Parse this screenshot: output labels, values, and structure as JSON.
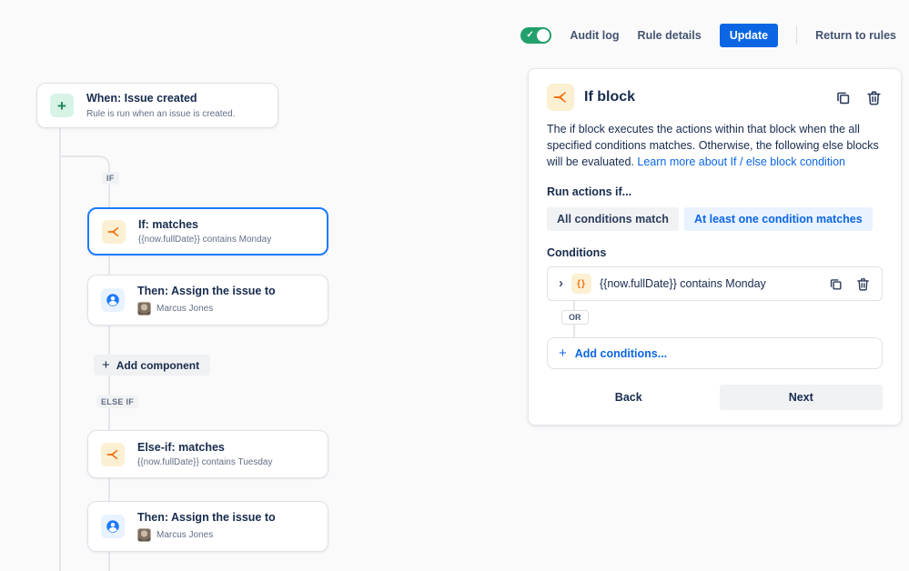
{
  "colors": {
    "accent_blue": "#0C66E4",
    "selected_border_blue": "#1D7AFC",
    "toggle_green": "#22A06B",
    "icon_orange": "#EE7213",
    "icon_orange_bg": "#FCF0D3",
    "icon_blue_bg": "#E9F2FF",
    "icon_green_bg": "#D6F3E6",
    "text_primary": "#172B4D",
    "text_secondary": "#626F86",
    "connector_gray": "#E4E6EA"
  },
  "icons": {
    "plus": "+",
    "check": "✓",
    "chevron_right": "›",
    "braces": "{}"
  },
  "topbar": {
    "audit_log": "Audit log",
    "rule_details": "Rule details",
    "update": "Update",
    "return_to_rules": "Return to rules"
  },
  "canvas": {
    "trigger": {
      "title": "When: Issue created",
      "subtitle": "Rule is run when an issue is created."
    },
    "if_badge": "IF",
    "else_if_badge": "ELSE IF",
    "if_card": {
      "title": "If: matches",
      "subtitle": "{{now.fullDate}} contains Monday"
    },
    "then_card_1": {
      "title": "Then: Assign the issue to",
      "user": "Marcus Jones"
    },
    "add_component": "Add component",
    "elseif_card": {
      "title": "Else-if: matches",
      "subtitle": "{{now.fullDate}} contains Tuesday"
    },
    "then_card_2": {
      "title": "Then: Assign the issue to",
      "user": "Marcus Jones"
    }
  },
  "panel": {
    "title": "If block",
    "description": "The if block executes the actions within that block when the all specified conditions matches. Otherwise, the following else blocks will be evaluated. ",
    "learn_more_link": "Learn more about If / else block condition",
    "run_actions_label": "Run actions if...",
    "option_all_match": "All conditions match",
    "option_any_match": "At least one condition matches",
    "conditions_label": "Conditions",
    "condition_text": "{{now.fullDate}} contains Monday",
    "or_badge": "OR",
    "add_conditions": "Add conditions...",
    "back": "Back",
    "next": "Next"
  }
}
